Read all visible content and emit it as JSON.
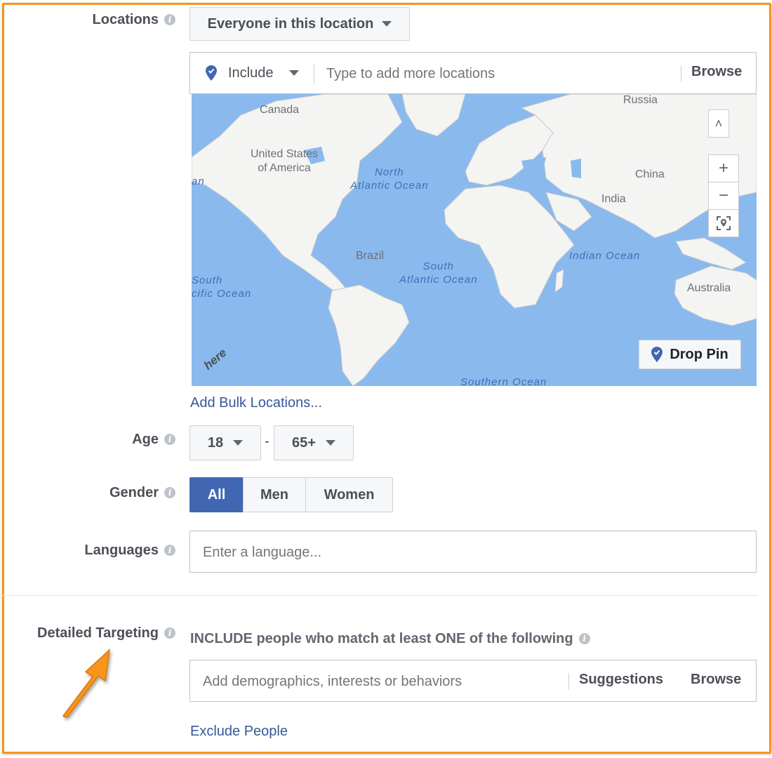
{
  "colors": {
    "accent": "#4267b2",
    "link": "#365899",
    "highlight_border": "#f7941d"
  },
  "locations": {
    "label": "Locations",
    "audience_select": "Everyone in this location",
    "include_select": "Include",
    "search_placeholder": "Type to add more locations",
    "browse_label": "Browse",
    "map": {
      "labels": {
        "canada": "Canada",
        "usa": "United States\nof America",
        "russia": "Russia",
        "china": "China",
        "india": "India",
        "brazil": "Brazil",
        "australia": "Australia"
      },
      "oceans": {
        "north_atlantic": "North\nAtlantic Ocean",
        "south_atlantic": "South\nAtlantic Ocean",
        "indian": "Indian Ocean",
        "south_pacific": "South\ncific Ocean",
        "southern": "Southern Ocean",
        "left_edge": "an"
      },
      "watermark": "here",
      "drop_pin_label": "Drop Pin",
      "zoom_in": "+",
      "zoom_out": "−",
      "collapse": "˄"
    },
    "bulk_link": "Add Bulk Locations..."
  },
  "age": {
    "label": "Age",
    "min": "18",
    "separator": "-",
    "max": "65+"
  },
  "gender": {
    "label": "Gender",
    "options": [
      "All",
      "Men",
      "Women"
    ],
    "selected": "All"
  },
  "languages": {
    "label": "Languages",
    "placeholder": "Enter a language..."
  },
  "detailed_targeting": {
    "label": "Detailed Targeting",
    "include_text": "INCLUDE people who match at least ONE of the following",
    "placeholder": "Add demographics, interests or behaviors",
    "suggestions_label": "Suggestions",
    "browse_label": "Browse",
    "exclude_link": "Exclude People"
  }
}
